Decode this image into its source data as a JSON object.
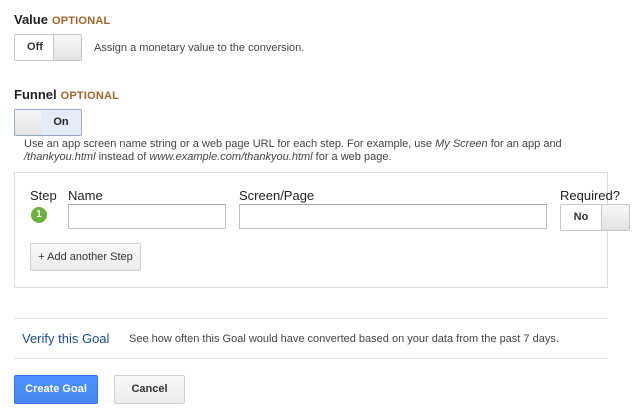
{
  "value_section": {
    "title": "Value",
    "optional": "OPTIONAL",
    "toggle_label": "Off",
    "toggle_state": "off",
    "description": "Assign a monetary value to the conversion."
  },
  "funnel_section": {
    "title": "Funnel",
    "optional": "OPTIONAL",
    "toggle_label": "On",
    "toggle_state": "on",
    "help": {
      "part1": "Use an app screen name string or a web page URL for each step. For example, use ",
      "example_app": "My Screen",
      "part2": " for an app and",
      "example_url": "/thankyou.html",
      "part3": " instead of ",
      "example_full_url": "www.example.com/thankyou.html",
      "part4": " for a web page."
    },
    "columns": {
      "step": "Step",
      "name": "Name",
      "screen_page": "Screen/Page",
      "required": "Required?"
    },
    "steps": [
      {
        "number": "1",
        "name": "",
        "screen_page": "",
        "required_label": "No"
      }
    ],
    "add_step_label": "+ Add another Step"
  },
  "verify": {
    "link_label": "Verify this Goal",
    "description": "See how often this Goal would have converted based on your data from the past 7 days."
  },
  "actions": {
    "create_label": "Create Goal",
    "cancel_label": "Cancel"
  },
  "colors": {
    "optional": "#a0662c",
    "link": "#1c4c8d",
    "primary": "#4787ed",
    "step_badge": "#6cb33e"
  }
}
